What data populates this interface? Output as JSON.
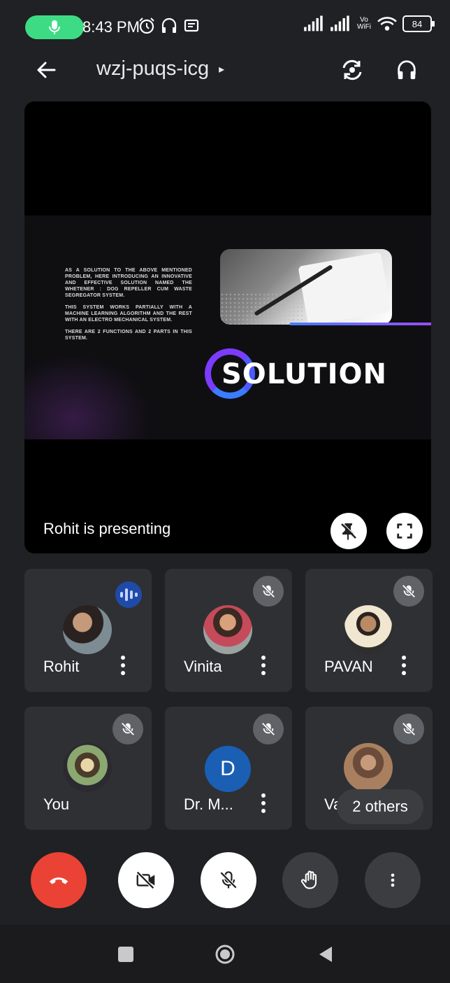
{
  "status_bar": {
    "time": "8:43 PM",
    "battery": "84",
    "mic_indicator_color": "#3ddc84",
    "left_icons": [
      "alarm-icon",
      "headset-icon",
      "notification-icon"
    ],
    "right_icons": [
      "signal-icon",
      "signal-icon",
      "vowifi-icon",
      "wifi-icon",
      "battery-icon"
    ],
    "vowifi": "Vo WiFi"
  },
  "header": {
    "meeting_code": "wzj-puqs-icg",
    "caret": "▸",
    "icons": [
      "back-arrow-icon",
      "switch-camera-icon",
      "audio-output-icon"
    ]
  },
  "presentation": {
    "label": "Rohit is presenting",
    "slide": {
      "paragraphs": [
        "AS A SOLUTION TO THE ABOVE MENTIONED PROBLEM, HERE INTRODUCING AN INNOVATIVE AND EFFECTIVE SOLUTION NAMED THE WHETENER : DOG REPELLER CUM WASTE SEGREGATOR SYSTEM.",
        "THIS SYSTEM WORKS PARTIALLY WITH A MACHINE LEARNING ALGORITHM AND THE REST WITH AN ELECTRO MECHANICAL SYSTEM.",
        "THERE ARE 2 FUNCTIONS AND 2 PARTS IN THIS SYSTEM."
      ],
      "title": "SOLUTION"
    },
    "buttons": [
      "unpin-icon",
      "fullscreen-icon"
    ]
  },
  "participants": [
    {
      "name": "Rohit",
      "state": "speaking",
      "avatar": "photo"
    },
    {
      "name": "Vinita",
      "state": "muted",
      "avatar": "photo"
    },
    {
      "name": "PAVAN",
      "state": "muted",
      "avatar": "photo"
    },
    {
      "name": "You",
      "state": "muted",
      "avatar": "photo"
    },
    {
      "name": "Dr. M...",
      "state": "muted",
      "avatar": "letter",
      "letter": "D"
    },
    {
      "name": "Va",
      "state": "muted",
      "avatar": "photo"
    }
  ],
  "others_chip": "2 others",
  "controls": {
    "items": [
      "end-call-icon",
      "camera-off-icon",
      "mic-off-icon",
      "raise-hand-icon",
      "more-options-icon"
    ],
    "end_call_color": "#ea4335"
  },
  "nav": [
    "recents-icon",
    "home-icon",
    "back-icon"
  ]
}
